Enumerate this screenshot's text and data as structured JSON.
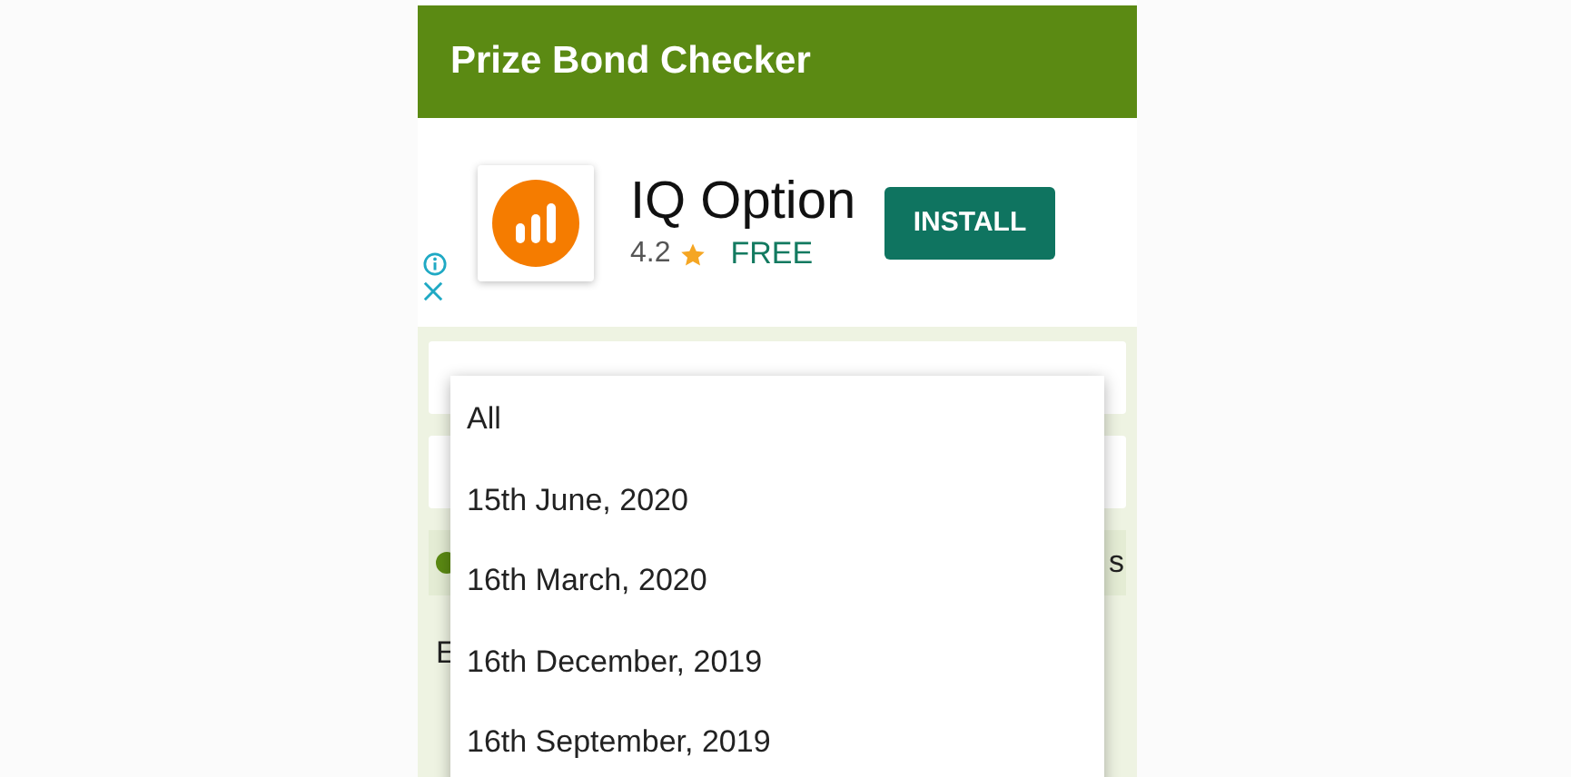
{
  "app_bar": {
    "title": "Prize Bond Checker"
  },
  "ad": {
    "app_name": "IQ Option",
    "rating": "4.2",
    "price": "FREE",
    "button": "INSTALL"
  },
  "form_behind": {
    "left_fragment": "E",
    "right_fragment": "s",
    "radio_selected": true
  },
  "dropdown": {
    "options": [
      {
        "label": "All"
      },
      {
        "label": "15th June, 2020"
      },
      {
        "label": "16th March, 2020"
      },
      {
        "label": "16th December, 2019"
      },
      {
        "label": "16th September, 2019"
      }
    ]
  }
}
